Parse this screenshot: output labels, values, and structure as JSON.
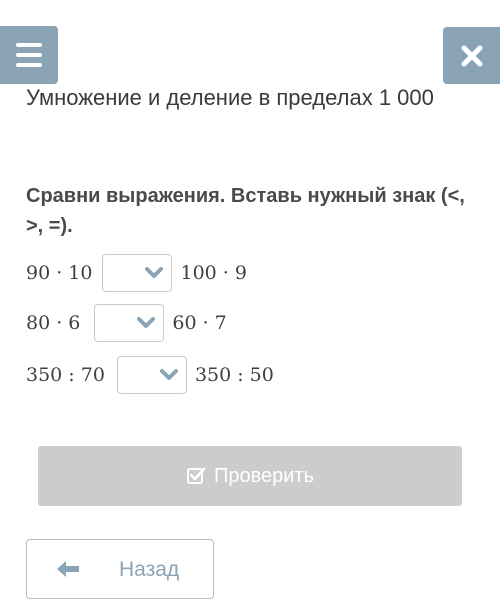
{
  "header": {
    "menu_icon": "hamburger-menu-icon",
    "close_icon": "close-icon",
    "accent_color": "#8aa4b6"
  },
  "lesson": {
    "title": "Умножение и деление в пределах 1 000"
  },
  "task": {
    "instruction": "Сравни выражения. Вставь нужный знак (<, >, =).",
    "rows": [
      {
        "left": "90 · 10",
        "selected": "",
        "right": "100 · 9"
      },
      {
        "left": "80 · 6",
        "selected": "",
        "right": "60 · 7"
      },
      {
        "left": "350 : 70",
        "selected": "",
        "right": "350 : 50"
      }
    ]
  },
  "actions": {
    "check_label": "Проверить",
    "check_icon": "check-square-icon",
    "back_label": "Назад",
    "back_icon": "arrow-left-icon",
    "disabled_color": "#cccccc"
  }
}
